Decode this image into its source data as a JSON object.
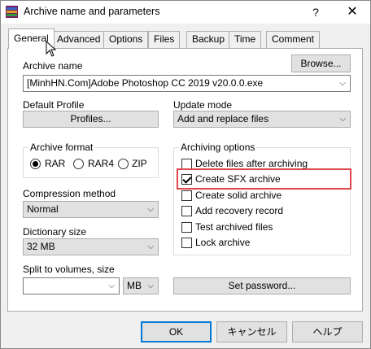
{
  "window": {
    "title": "Archive name and parameters",
    "help_glyph": "?",
    "close_glyph": "✕"
  },
  "tabs": [
    {
      "label": "General",
      "active": true
    },
    {
      "label": "Advanced"
    },
    {
      "label": "Options"
    },
    {
      "label": "Files"
    },
    {
      "label": "Backup"
    },
    {
      "label": "Time"
    },
    {
      "label": "Comment"
    }
  ],
  "archive": {
    "name_label": "Archive name",
    "browse_label": "Browse...",
    "name_value": "[MinhHN.Com]Adobe Photoshop CC 2019 v20.0.0.exe"
  },
  "profile": {
    "label": "Default Profile",
    "button_label": "Profiles..."
  },
  "update": {
    "label": "Update mode",
    "value": "Add and replace files"
  },
  "format": {
    "title": "Archive format",
    "options": [
      "RAR",
      "RAR4",
      "ZIP"
    ],
    "selected": "RAR"
  },
  "compression": {
    "label": "Compression method",
    "value": "Normal"
  },
  "dictionary": {
    "label": "Dictionary size",
    "value": "32 MB"
  },
  "split": {
    "label": "Split to volumes, size",
    "value": "",
    "unit": "MB"
  },
  "options": {
    "title": "Archiving options",
    "items": [
      {
        "label": "Delete files after archiving",
        "checked": false
      },
      {
        "label": "Create SFX archive",
        "checked": true
      },
      {
        "label": "Create solid archive",
        "checked": false
      },
      {
        "label": "Add recovery record",
        "checked": false
      },
      {
        "label": "Test archived files",
        "checked": false
      },
      {
        "label": "Lock archive",
        "checked": false
      }
    ]
  },
  "password_label": "Set password...",
  "footer": {
    "ok": "OK",
    "cancel": "キャンセル",
    "help": "ヘルプ"
  },
  "colors": {
    "highlight": "#e0464b",
    "focus": "#0078d7"
  },
  "icons": {
    "app": "winrar-icon",
    "cursor": "mouse-cursor-icon"
  }
}
